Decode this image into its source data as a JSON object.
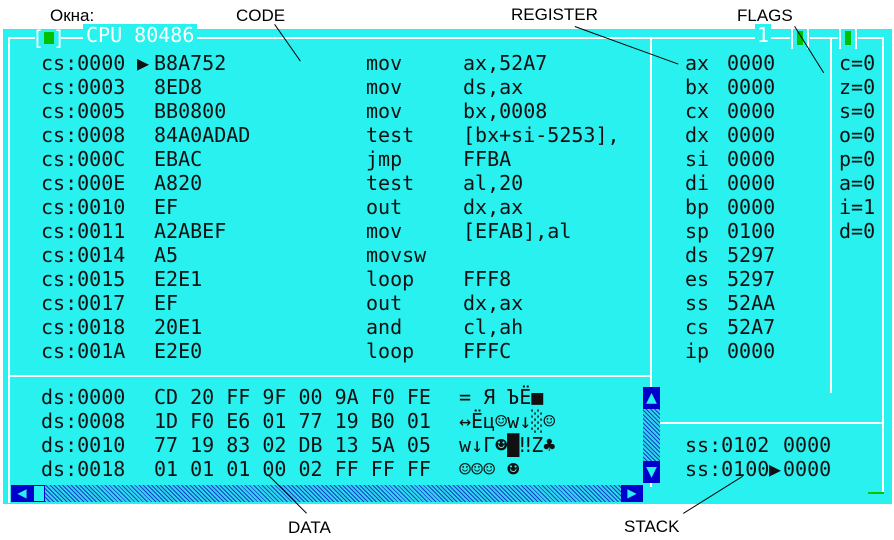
{
  "annotations": {
    "windows_label": "Окна:",
    "code": "CODE",
    "register": "REGISTER",
    "flags": "FLAGS",
    "data": "DATA",
    "stack": "STACK"
  },
  "window": {
    "title": "CPU 80486",
    "number": "1",
    "close_icon": "close-box-icon",
    "colors": {
      "background": "#29f1ef",
      "frame": "#ffffff",
      "close": "#00c000",
      "scroll": "#0000cc"
    }
  },
  "code": [
    {
      "addr": "cs:0000",
      "marker": "▶",
      "bytes": "B8A752",
      "mnem": "mov",
      "ops": "ax,52A7"
    },
    {
      "addr": "cs:0003",
      "marker": " ",
      "bytes": "8ED8",
      "mnem": "mov",
      "ops": "ds,ax"
    },
    {
      "addr": "cs:0005",
      "marker": " ",
      "bytes": "BB0800",
      "mnem": "mov",
      "ops": "bx,0008"
    },
    {
      "addr": "cs:0008",
      "marker": " ",
      "bytes": "84A0ADAD",
      "mnem": "test",
      "ops": "[bx+si-5253],"
    },
    {
      "addr": "cs:000C",
      "marker": " ",
      "bytes": "EBAC",
      "mnem": "jmp",
      "ops": "FFBA"
    },
    {
      "addr": "cs:000E",
      "marker": " ",
      "bytes": "A820",
      "mnem": "test",
      "ops": "al,20"
    },
    {
      "addr": "cs:0010",
      "marker": " ",
      "bytes": "EF",
      "mnem": "out",
      "ops": "dx,ax"
    },
    {
      "addr": "cs:0011",
      "marker": " ",
      "bytes": "A2ABEF",
      "mnem": "mov",
      "ops": "[EFAB],al"
    },
    {
      "addr": "cs:0014",
      "marker": " ",
      "bytes": "A5",
      "mnem": "movsw",
      "ops": ""
    },
    {
      "addr": "cs:0015",
      "marker": " ",
      "bytes": "E2E1",
      "mnem": "loop",
      "ops": "FFF8"
    },
    {
      "addr": "cs:0017",
      "marker": " ",
      "bytes": "EF",
      "mnem": "out",
      "ops": "dx,ax"
    },
    {
      "addr": "cs:0018",
      "marker": " ",
      "bytes": "20E1",
      "mnem": "and",
      "ops": "cl,ah"
    },
    {
      "addr": "cs:001A",
      "marker": " ",
      "bytes": "E2E0",
      "mnem": "loop",
      "ops": "FFFC"
    }
  ],
  "registers": [
    {
      "name": "ax",
      "value": "0000"
    },
    {
      "name": "bx",
      "value": "0000"
    },
    {
      "name": "cx",
      "value": "0000"
    },
    {
      "name": "dx",
      "value": "0000"
    },
    {
      "name": "si",
      "value": "0000"
    },
    {
      "name": "di",
      "value": "0000"
    },
    {
      "name": "bp",
      "value": "0000"
    },
    {
      "name": "sp",
      "value": "0100"
    },
    {
      "name": "ds",
      "value": "5297"
    },
    {
      "name": "es",
      "value": "5297"
    },
    {
      "name": "ss",
      "value": "52AA"
    },
    {
      "name": "cs",
      "value": "52A7"
    },
    {
      "name": "ip",
      "value": "0000"
    }
  ],
  "flags": [
    "c=0",
    "z=0",
    "s=0",
    "o=0",
    "p=0",
    "a=0",
    "i=1",
    "d=0"
  ],
  "dump": [
    {
      "addr": "ds:0000",
      "bytes": "CD 20 FF 9F 00 9A F0 FE",
      "chars": "= Я ЪЁ■"
    },
    {
      "addr": "ds:0008",
      "bytes": "1D F0 E6 01 77 19 B0 01",
      "chars": "↔Ёц☺w↓░☺"
    },
    {
      "addr": "ds:0010",
      "bytes": "77 19 83 02 DB 13 5A 05",
      "chars": "w↓Г☻█‼Z♣"
    },
    {
      "addr": "ds:0018",
      "bytes": "01 01 01 00 02 FF FF FF",
      "chars": "☺☺☺ ☻"
    }
  ],
  "stack": [
    {
      "addr": "ss:0102",
      "marker": " ",
      "value": "0000"
    },
    {
      "addr": "ss:0100",
      "marker": "▶",
      "value": "0000"
    }
  ],
  "scrollbars": {
    "up": "▲",
    "down": "▼",
    "left": "◀",
    "right": "▶"
  }
}
